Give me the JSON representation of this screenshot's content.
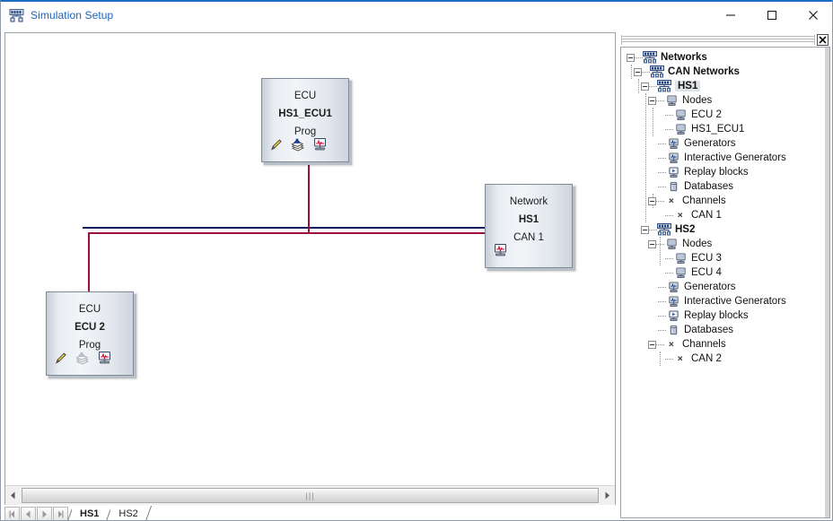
{
  "window": {
    "title": "Simulation Setup",
    "icon": "simulation-setup-icon",
    "minimize_label": "–",
    "maximize_label": "□",
    "close_label": "×"
  },
  "canvas": {
    "nodes": [
      {
        "id": "hs1-ecu1",
        "line1": "ECU",
        "line2": "HS1_ECU1",
        "line3": "Prog",
        "icons": [
          "pencil-icon",
          "database-stack-icon",
          "monitor-signal-icon"
        ],
        "icons_dimmed": false
      },
      {
        "id": "ecu2",
        "line1": "ECU",
        "line2": "ECU 2",
        "line3": "Prog",
        "icons": [
          "pencil-icon",
          "database-stack-icon",
          "monitor-signal-icon"
        ],
        "icons_dimmed": true
      },
      {
        "id": "network-hs1",
        "line1": "Network",
        "line2": "HS1",
        "line3": "CAN 1",
        "icons": [
          "monitor-signal-icon"
        ],
        "icons_dimmed": false
      }
    ],
    "bus_color_primary": "#0c1a5e",
    "bus_color_secondary": "#9b0d3e",
    "scrollbar": {
      "grip": "‖‖",
      "left_arrow": "◀",
      "right_arrow": "▶"
    }
  },
  "tabstrip": {
    "nav_buttons": [
      "first-record-button",
      "previous-record-button",
      "next-record-button",
      "last-record-button"
    ],
    "nav_glyphs": [
      "◀❙",
      "◀",
      "▶",
      "❙▶"
    ],
    "tabs": [
      {
        "label": "HS1",
        "active": true
      },
      {
        "label": "HS2",
        "active": false
      }
    ]
  },
  "tree_panel": {
    "close_label": "✕",
    "rows": [
      {
        "depth": 0,
        "twist": "minus",
        "icon": "network-group-icon",
        "label": "Networks",
        "bold": true,
        "selected": false
      },
      {
        "depth": 1,
        "twist": "minus",
        "icon": "network-group-icon",
        "label": "CAN Networks",
        "bold": true,
        "selected": false
      },
      {
        "depth": 2,
        "twist": "minus",
        "icon": "network-group-icon",
        "label": "HS1",
        "bold": true,
        "selected": true
      },
      {
        "depth": 3,
        "twist": "minus",
        "icon": "node-icon",
        "label": "Nodes",
        "bold": false,
        "selected": false
      },
      {
        "depth": 4,
        "twist": "none",
        "icon": "node-icon",
        "label": "ECU 2",
        "bold": false,
        "selected": false
      },
      {
        "depth": 4,
        "twist": "none",
        "icon": "node-icon",
        "label": "HS1_ECU1",
        "bold": false,
        "selected": false
      },
      {
        "depth": 3,
        "twist": "none",
        "icon": "generator-icon",
        "label": "Generators",
        "bold": false,
        "selected": false
      },
      {
        "depth": 3,
        "twist": "none",
        "icon": "generator-icon",
        "label": "Interactive Generators",
        "bold": false,
        "selected": false
      },
      {
        "depth": 3,
        "twist": "none",
        "icon": "replay-icon",
        "label": "Replay blocks",
        "bold": false,
        "selected": false
      },
      {
        "depth": 3,
        "twist": "none",
        "icon": "database-icon",
        "label": "Databases",
        "bold": false,
        "selected": false
      },
      {
        "depth": 3,
        "twist": "minus",
        "icon": "channel-icon",
        "label": "Channels",
        "bold": false,
        "selected": false
      },
      {
        "depth": 4,
        "twist": "none",
        "icon": "channel-icon",
        "label": "CAN 1",
        "bold": false,
        "selected": false
      },
      {
        "depth": 2,
        "twist": "minus",
        "icon": "network-group-icon",
        "label": "HS2",
        "bold": true,
        "selected": false
      },
      {
        "depth": 3,
        "twist": "minus",
        "icon": "node-icon",
        "label": "Nodes",
        "bold": false,
        "selected": false
      },
      {
        "depth": 4,
        "twist": "none",
        "icon": "node-icon",
        "label": "ECU 3",
        "bold": false,
        "selected": false
      },
      {
        "depth": 4,
        "twist": "none",
        "icon": "node-icon",
        "label": "ECU 4",
        "bold": false,
        "selected": false
      },
      {
        "depth": 3,
        "twist": "none",
        "icon": "generator-icon",
        "label": "Generators",
        "bold": false,
        "selected": false
      },
      {
        "depth": 3,
        "twist": "none",
        "icon": "generator-icon",
        "label": "Interactive Generators",
        "bold": false,
        "selected": false
      },
      {
        "depth": 3,
        "twist": "none",
        "icon": "replay-icon",
        "label": "Replay blocks",
        "bold": false,
        "selected": false
      },
      {
        "depth": 3,
        "twist": "none",
        "icon": "database-icon",
        "label": "Databases",
        "bold": false,
        "selected": false
      },
      {
        "depth": 3,
        "twist": "minus",
        "icon": "channel-icon",
        "label": "Channels",
        "bold": false,
        "selected": false
      },
      {
        "depth": 4,
        "twist": "none",
        "icon": "channel-icon",
        "label": "CAN 2",
        "bold": false,
        "selected": false
      }
    ]
  }
}
